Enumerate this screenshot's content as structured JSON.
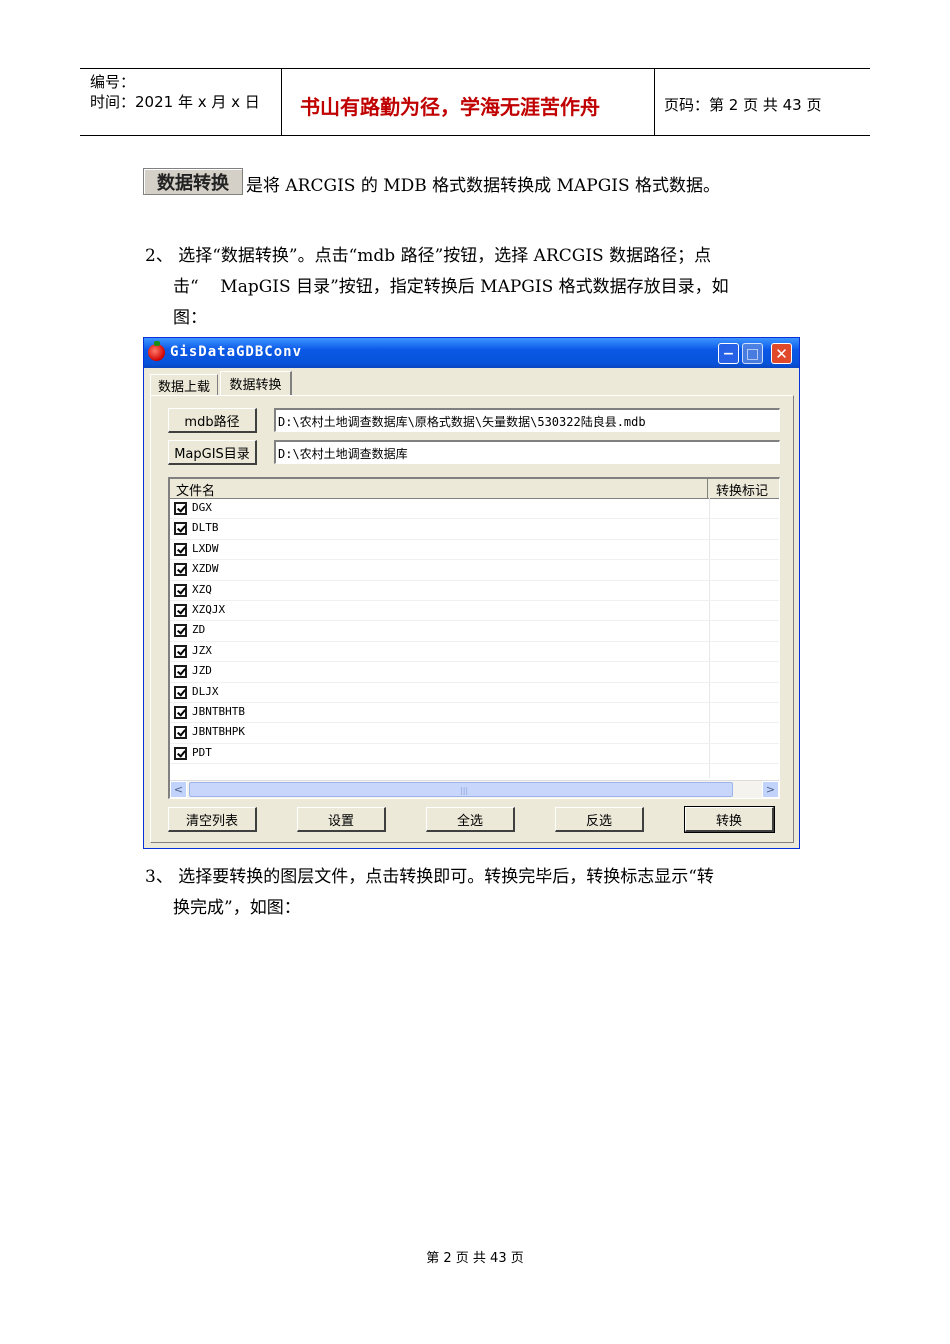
{
  "header": {
    "number_label": "编号：",
    "time_label": "时间：2021 年 x 月 x 日",
    "motto": "书山有路勤为径，学海无涯苦作舟",
    "page_info": "页码：第 2 页  共 43 页"
  },
  "intro": {
    "button_image_label": "数据转换",
    "text": "是将 ARCGIS 的 MDB 格式数据转换成 MAPGIS 格式数据。"
  },
  "step2": {
    "line1": "2、 选择“数据转换”。点击“mdb 路径”按钮，选择 ARCGIS 数据路径；点",
    "line2": "击“    MapGIS 目录”按钮，指定转换后 MAPGIS 格式数据存放目录，如",
    "line3": "图："
  },
  "window": {
    "title": "GisDataGDBConv",
    "tabs": [
      "数据上载",
      "数据转换"
    ],
    "mdb_button": "mdb路径",
    "mdb_path": "D:\\农村土地调查数据库\\原格式数据\\矢量数据\\530322陆良县.mdb",
    "mapgis_button": "MapGIS目录",
    "mapgis_path": "D:\\农村土地调查数据库",
    "list": {
      "col_name": "文件名",
      "col_flag": "转换标记",
      "items": [
        "DGX",
        "DLTB",
        "LXDW",
        "XZDW",
        "XZQ",
        "XZQJX",
        "ZD",
        "JZX",
        "JZD",
        "DLJX",
        "JBNTBHTB",
        "JBNTBHPK",
        "PDT"
      ]
    },
    "buttons": {
      "clear": "清空列表",
      "settings": "设置",
      "select_all": "全选",
      "invert": "反选",
      "convert": "转换"
    },
    "scroll_left": "<",
    "scroll_right": ">",
    "scroll_grip": "|||"
  },
  "step3": {
    "line1": "3、 选择要转换的图层文件，点击转换即可。转换完毕后，转换标志显示“转",
    "line2": "换完成”，如图："
  },
  "footer": {
    "text": "第  2  页  共  43  页"
  }
}
